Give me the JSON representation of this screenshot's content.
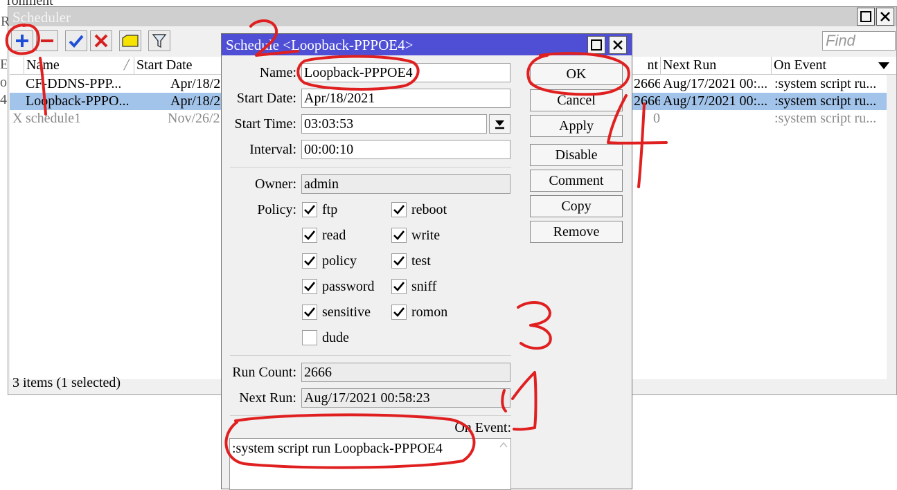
{
  "background_window": {
    "title_fragment": "ronment"
  },
  "scheduler": {
    "title": "Scheduler",
    "find_placeholder": "Find",
    "left_edge_fragments": [
      "R",
      "E",
      "od",
      "4"
    ],
    "columns": {
      "name": "Name",
      "start_date": "Start Date",
      "run_count_fragment": "nt",
      "next_run": "Next Run",
      "on_event": "On Event"
    },
    "rows": [
      {
        "flag": "",
        "name": "CF-DDNS-PPP...",
        "start_date": "Apr/18/2",
        "run_count": "2666",
        "next_run": "Aug/17/2021 00:...",
        "on_event": ":system script ru...",
        "selected": false,
        "disabled": false
      },
      {
        "flag": "",
        "name": "Loopback-PPPO...",
        "start_date": "Apr/18/2",
        "run_count": "2666",
        "next_run": "Aug/17/2021 00:...",
        "on_event": ":system script ru...",
        "selected": true,
        "disabled": false
      },
      {
        "flag": "X",
        "name": "schedule1",
        "start_date": "Nov/26/2",
        "run_count": "0",
        "next_run": "",
        "on_event": ":system script ru...",
        "selected": false,
        "disabled": true
      }
    ],
    "status": "3 items (1 selected)"
  },
  "dialog": {
    "title": "Schedule <Loopback-PPPOE4>",
    "name_label": "Name:",
    "name_value": "Loopback-PPPOE4",
    "start_date_label": "Start Date:",
    "start_date_value": "Apr/18/2021",
    "start_time_label": "Start Time:",
    "start_time_value": "03:03:53",
    "interval_label": "Interval:",
    "interval_value": "00:00:10",
    "owner_label": "Owner:",
    "owner_value": "admin",
    "policy_label": "Policy:",
    "policies": [
      {
        "label": "ftp",
        "checked": true
      },
      {
        "label": "reboot",
        "checked": true
      },
      {
        "label": "read",
        "checked": true
      },
      {
        "label": "write",
        "checked": true
      },
      {
        "label": "policy",
        "checked": true
      },
      {
        "label": "test",
        "checked": true
      },
      {
        "label": "password",
        "checked": true
      },
      {
        "label": "sniff",
        "checked": true
      },
      {
        "label": "sensitive",
        "checked": true
      },
      {
        "label": "romon",
        "checked": true
      },
      {
        "label": "dude",
        "checked": false
      }
    ],
    "run_count_label": "Run Count:",
    "run_count_value": "2666",
    "next_run_label": "Next Run:",
    "next_run_value": "Aug/17/2021 00:58:23",
    "on_event_label": "On Event:",
    "on_event_value": ":system script run Loopback-PPPOE4",
    "buttons": {
      "ok": "OK",
      "cancel": "Cancel",
      "apply": "Apply",
      "disable": "Disable",
      "comment": "Comment",
      "copy": "Copy",
      "remove": "Remove"
    }
  },
  "annotations": {
    "color": "#e02020",
    "numbers": [
      "1",
      "2",
      "3",
      "4"
    ]
  },
  "colors": {
    "selected_row": "#a3c4ea",
    "dialog_title": "#4f4fd6",
    "add_icon": "#1f4fd6",
    "remove_icon": "#d62020"
  }
}
